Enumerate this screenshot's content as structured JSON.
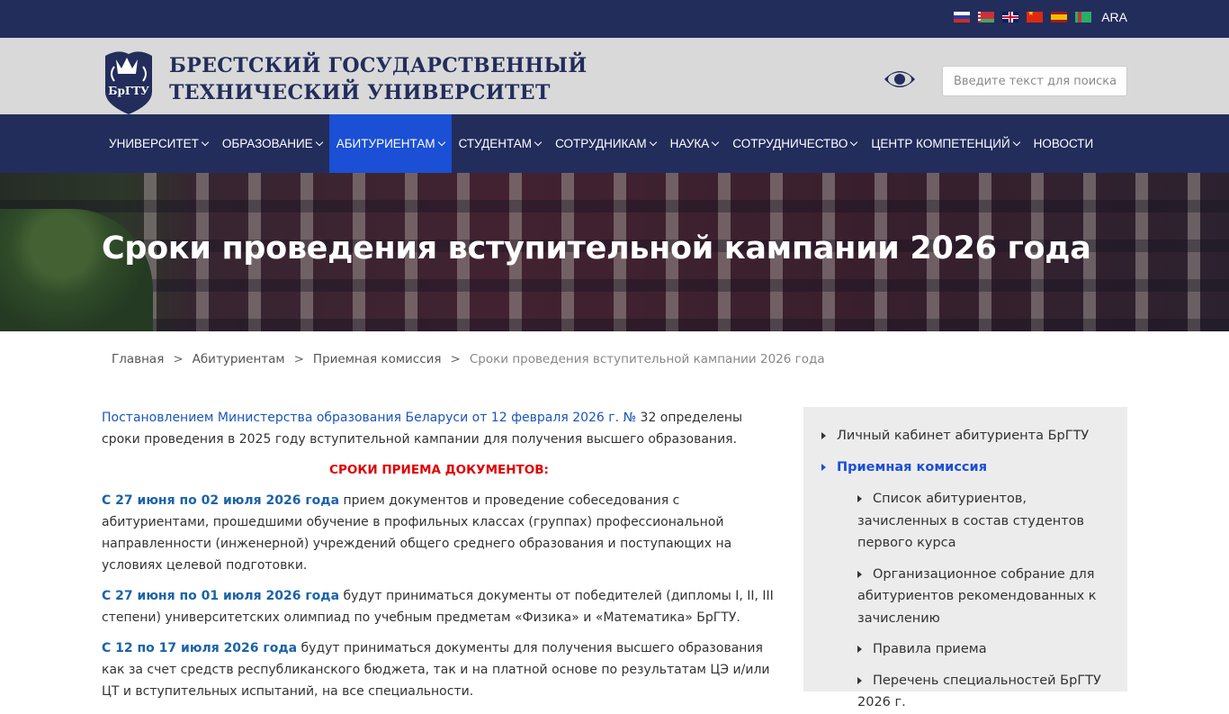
{
  "topbar": {
    "languages": [
      {
        "code": "ru",
        "icon": "russia-flag-icon"
      },
      {
        "code": "by",
        "icon": "belarus-flag-icon"
      },
      {
        "code": "gb",
        "icon": "uk-flag-icon"
      },
      {
        "code": "cn",
        "icon": "china-flag-icon"
      },
      {
        "code": "es",
        "icon": "spain-flag-icon"
      },
      {
        "code": "tm",
        "icon": "turkmenistan-flag-icon"
      }
    ],
    "lang_text": "ARA"
  },
  "header": {
    "logo_line1": "БРЕСТСКИЙ ГОСУДАРСТВЕННЫЙ",
    "logo_line2": "ТЕХНИЧЕСКИЙ УНИВЕРСИТЕТ",
    "emblem_text": "БрГТУ",
    "search_placeholder": "Введите текст для поиска",
    "accessibility_icon": "eye-icon"
  },
  "nav": {
    "items": [
      {
        "label": "УНИВЕРСИТЕТ",
        "dropdown": true,
        "active": false
      },
      {
        "label": "ОБРАЗОВАНИЕ",
        "dropdown": true,
        "active": false
      },
      {
        "label": "АБИТУРИЕНТАМ",
        "dropdown": true,
        "active": true
      },
      {
        "label": "СТУДЕНТАМ",
        "dropdown": true,
        "active": false
      },
      {
        "label": "СОТРУДНИКАМ",
        "dropdown": true,
        "active": false
      },
      {
        "label": "НАУКА",
        "dropdown": true,
        "active": false
      },
      {
        "label": "СОТРУДНИЧЕСТВО",
        "dropdown": true,
        "active": false
      },
      {
        "label": "ЦЕНТР КОМПЕТЕНЦИЙ",
        "dropdown": true,
        "active": false
      },
      {
        "label": "НОВОСТИ",
        "dropdown": false,
        "active": false
      }
    ]
  },
  "hero": {
    "title": "Сроки проведения вступительной кампании 2026 года"
  },
  "breadcrumbs": {
    "separator": ">",
    "items": [
      "Главная",
      "Абитуриентам",
      "Приемная комиссия"
    ],
    "current": "Сроки проведения вступительной кампании 2026 года"
  },
  "content": {
    "intro_link": "Постановлением Министерства образования Беларуси от 12 февраля 2026 г. №",
    "intro_rest": " 32 определены сроки проведения в 2025 году вступительной кампании для получения высшего образования.",
    "heading": "СРОКИ ПРИЕМА ДОКУМЕНТОВ:",
    "paragraphs": [
      {
        "date": "С 27 июня по 02 июля 2026 года",
        "text": " прием документов и проведение собеседования с абитуриентами, прошедшими обучение в профильных классах (группах) профессиональной направленности (инженерной) учреждений общего среднего образования и поступающих на условиях целевой подготовки."
      },
      {
        "date": "С 27 июня по 01 июля 2026 года",
        "text": " будут приниматься документы от победителей (дипломы I, II, III степени) университетских олимпиад по учебным предметам «Физика» и «Математика» БрГТУ."
      },
      {
        "date": "С 12 по 17 июля 2026 года",
        "text": " будут приниматься документы для получения высшего образования как за счет средств республиканского бюджета, так и на платной основе по результатам ЦЭ и/или ЦТ и вступительных испытаний, на все специальности."
      }
    ]
  },
  "sidebar": {
    "items": [
      {
        "label": "Личный кабинет абитуриента БрГТУ",
        "active": false
      },
      {
        "label": "Приемная комиссия",
        "active": true
      }
    ],
    "subitems": [
      "Список абитуриентов, зачисленных в состав студентов первого курса",
      "Организационное собрание для абитуриентов рекомендованных к зачислению",
      "Правила приема",
      "Перечень специальностей БрГТУ 2026 г."
    ]
  },
  "colors": {
    "navy": "#222d5c",
    "active_nav": "#1a4fd6",
    "link": "#1a56b8",
    "date": "#1b63a8",
    "heading_red": "#e00000"
  }
}
